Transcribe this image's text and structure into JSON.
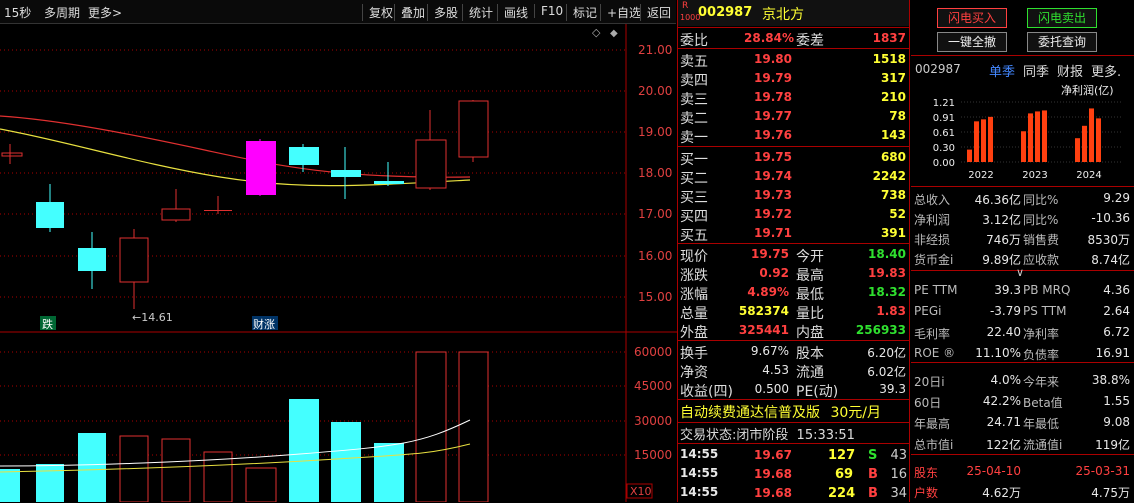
{
  "topbar": {
    "period": "15秒",
    "multi": "多周期",
    "more": "更多>",
    "buttons": [
      "复权",
      "叠加",
      "多股",
      "统计",
      "画线",
      "F10",
      "标记",
      "+自选",
      "返回"
    ]
  },
  "kline": {
    "yticks": [
      "21.00",
      "20.00",
      "19.00",
      "18.00",
      "17.00",
      "16.00",
      "15.00"
    ],
    "low_label": "←14.61",
    "tag_die": "跌",
    "tag_caizhang": "财涨"
  },
  "volume": {
    "yticks": [
      "60000",
      "45000",
      "30000",
      "15000"
    ],
    "unit": "X10"
  },
  "quote": {
    "code_prefix": "R",
    "code_sub": "1000",
    "code": "002987",
    "name": "京北方",
    "weibi_label": "委比",
    "weibi": "28.84%",
    "weicha_label": "委差",
    "weicha": "1837",
    "asks": [
      {
        "l": "卖五",
        "p": "19.80",
        "v": "1518"
      },
      {
        "l": "卖四",
        "p": "19.79",
        "v": "317"
      },
      {
        "l": "卖三",
        "p": "19.78",
        "v": "210"
      },
      {
        "l": "卖二",
        "p": "19.77",
        "v": "78"
      },
      {
        "l": "卖一",
        "p": "19.76",
        "v": "143"
      }
    ],
    "bids": [
      {
        "l": "买一",
        "p": "19.75",
        "v": "680"
      },
      {
        "l": "买二",
        "p": "19.74",
        "v": "2242"
      },
      {
        "l": "买三",
        "p": "19.73",
        "v": "738"
      },
      {
        "l": "买四",
        "p": "19.72",
        "v": "52"
      },
      {
        "l": "买五",
        "p": "19.71",
        "v": "391"
      }
    ],
    "stats": [
      {
        "l1": "现价",
        "v1": "19.75",
        "l2": "今开",
        "v2": "18.40",
        "c2": "green"
      },
      {
        "l1": "涨跌",
        "v1": "0.92",
        "l2": "最高",
        "v2": "19.83",
        "c2": "red"
      },
      {
        "l1": "涨幅",
        "v1": "4.89%",
        "l2": "最低",
        "v2": "18.32",
        "c2": "green"
      },
      {
        "l1": "总量",
        "v1": "582374",
        "l2": "量比",
        "v2": "1.83",
        "c1": "yellow",
        "c2": "red"
      },
      {
        "l1": "外盘",
        "v1": "325441",
        "l2": "内盘",
        "v2": "256933",
        "c1": "red",
        "c2": "green"
      }
    ],
    "stats2": [
      {
        "l1": "换手",
        "v1": "9.67%",
        "l2": "股本",
        "v2": "6.20亿"
      },
      {
        "l1": "净资",
        "v1": "4.53",
        "l2": "流通",
        "v2": "6.02亿"
      },
      {
        "l1": "收益(四)",
        "v1": "0.500",
        "l2": "PE(动)",
        "v2": "39.3"
      }
    ],
    "ad": "自动续费通达信普及版",
    "ad_price": "30元/月",
    "status_label": "交易状态:",
    "status": "闭市阶段",
    "status_time": "15:33:51",
    "ticks": [
      {
        "t": "14:55",
        "p": "19.67",
        "v": "127",
        "s": "S",
        "n": "43"
      },
      {
        "t": "14:55",
        "p": "19.68",
        "v": "69",
        "s": "B",
        "n": "16"
      },
      {
        "t": "14:55",
        "p": "19.68",
        "v": "224",
        "s": "B",
        "n": "34"
      }
    ]
  },
  "right": {
    "buy_btn": "闪电买入",
    "sell_btn": "闪电卖出",
    "cancel_btn": "一键全撤",
    "query_btn": "委托查询",
    "code": "002987",
    "tabs": [
      "单季",
      "同季",
      "财报",
      "更多."
    ],
    "chart_title": "净利润(亿)",
    "rows": [
      {
        "a": "总收入",
        "b": "46.36亿",
        "c": "同比%",
        "d": "9.29"
      },
      {
        "a": "净利润",
        "b": "3.12亿",
        "c": "同比%",
        "d": "-10.36"
      },
      {
        "a": "非经损",
        "b": "746万",
        "c": "销售费",
        "d": "8530万"
      },
      {
        "a": "货币金i",
        "b": "9.89亿",
        "c": "应收款",
        "d": "8.74亿"
      },
      {
        "a": "PE TTM",
        "b": "39.3",
        "c": "PB MRQ",
        "d": "4.36"
      },
      {
        "a": "PEGi",
        "b": "-3.79",
        "c": "PS TTM",
        "d": "2.64"
      },
      {
        "a": "毛利率",
        "b": "22.40",
        "c": "净利率",
        "d": "6.72"
      },
      {
        "a": "ROE ®",
        "b": "11.10%",
        "c": "负债率",
        "d": "16.91"
      },
      {
        "a": "20日i",
        "b": "4.0%",
        "c": "今年来",
        "d": "38.8%"
      },
      {
        "a": "60日",
        "b": "42.2%",
        "c": "Beta值",
        "d": "1.55"
      },
      {
        "a": "年最高",
        "b": "24.71",
        "c": "年最低",
        "d": "9.08"
      },
      {
        "a": "总市值i",
        "b": "122亿",
        "c": "流通值i",
        "d": "119亿"
      },
      {
        "a": "股东",
        "b": "25-04-10",
        "c": "",
        "d": "25-03-31"
      },
      {
        "a": "户数",
        "b": "4.62万",
        "c": "",
        "d": "4.75万"
      }
    ],
    "expand": "∨"
  },
  "chart_data": {
    "type": "bar",
    "title": "净利润(亿)",
    "ytick_labels": [
      "1.21",
      "0.91",
      "0.61",
      "0.30",
      "0.00"
    ],
    "ylim": [
      0,
      1.21
    ],
    "groups": [
      "2022",
      "2023",
      "2024"
    ],
    "values": [
      [
        0.25,
        0.82,
        0.86,
        0.91
      ],
      [
        0.62,
        0.98,
        1.02,
        1.04
      ],
      [
        0.48,
        0.73,
        1.08,
        0.88
      ]
    ]
  }
}
